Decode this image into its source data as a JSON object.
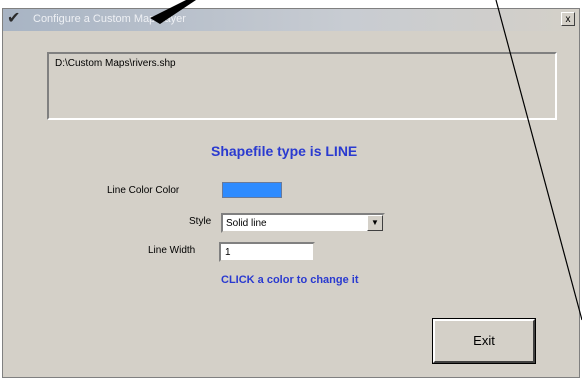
{
  "window": {
    "title": "Configure a Custom Map Layer",
    "close_glyph": "x"
  },
  "path_box": {
    "value": "D:\\Custom Maps\\rivers.shp"
  },
  "shapefile_type_text": "Shapefile type is LINE",
  "form": {
    "line_color_label": "Line Color Color",
    "line_color_value": "#2e8bff",
    "style_label": "Style",
    "style_value": "Solid line",
    "line_width_label": "Line Width",
    "line_width_value": "1"
  },
  "click_hint": "CLICK a color to change it",
  "exit_button": {
    "label": "Exit"
  },
  "colors": {
    "accent_text": "#2a3ad0",
    "dialog_bg": "#d4d0c8",
    "swatch": "#2e8bff"
  }
}
